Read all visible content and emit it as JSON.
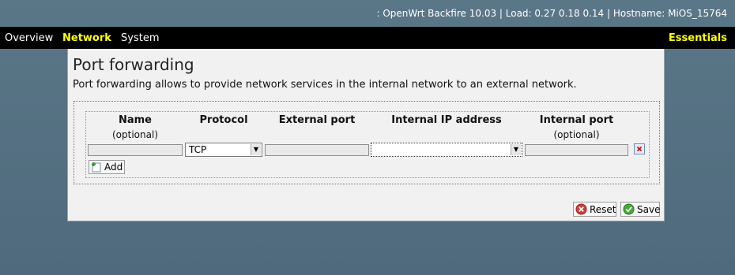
{
  "header": {
    "status": ": OpenWrt Backfire 10.03 | Load: 0.27 0.18 0.14 | Hostname: MiOS_15764"
  },
  "menu": {
    "items": [
      {
        "label": "Overview",
        "active": false
      },
      {
        "label": "Network",
        "active": true
      },
      {
        "label": "System",
        "active": false
      }
    ],
    "essentials": "Essentials"
  },
  "page": {
    "title": "Port forwarding",
    "description": "Port forwarding allows to provide network services in the internal network to an external network."
  },
  "table": {
    "columns": [
      {
        "header": "Name",
        "sub": "(optional)"
      },
      {
        "header": "Protocol",
        "sub": ""
      },
      {
        "header": "External port",
        "sub": ""
      },
      {
        "header": "Internal IP address",
        "sub": ""
      },
      {
        "header": "Internal port",
        "sub": "(optional)"
      }
    ],
    "row": {
      "name": "",
      "protocol": "TCP",
      "external_port": "",
      "internal_ip": "",
      "internal_port": ""
    },
    "add_label": "Add"
  },
  "actions": {
    "reset_label": "Reset",
    "save_label": "Save"
  },
  "colors": {
    "background": "#527083",
    "menubar": "#000000",
    "menu_active": "#ffff00",
    "panel": "#f1f1f1"
  },
  "icons": {
    "remove": "remove-row-icon",
    "add": "add-icon",
    "reset": "reset-icon",
    "save": "save-icon"
  }
}
